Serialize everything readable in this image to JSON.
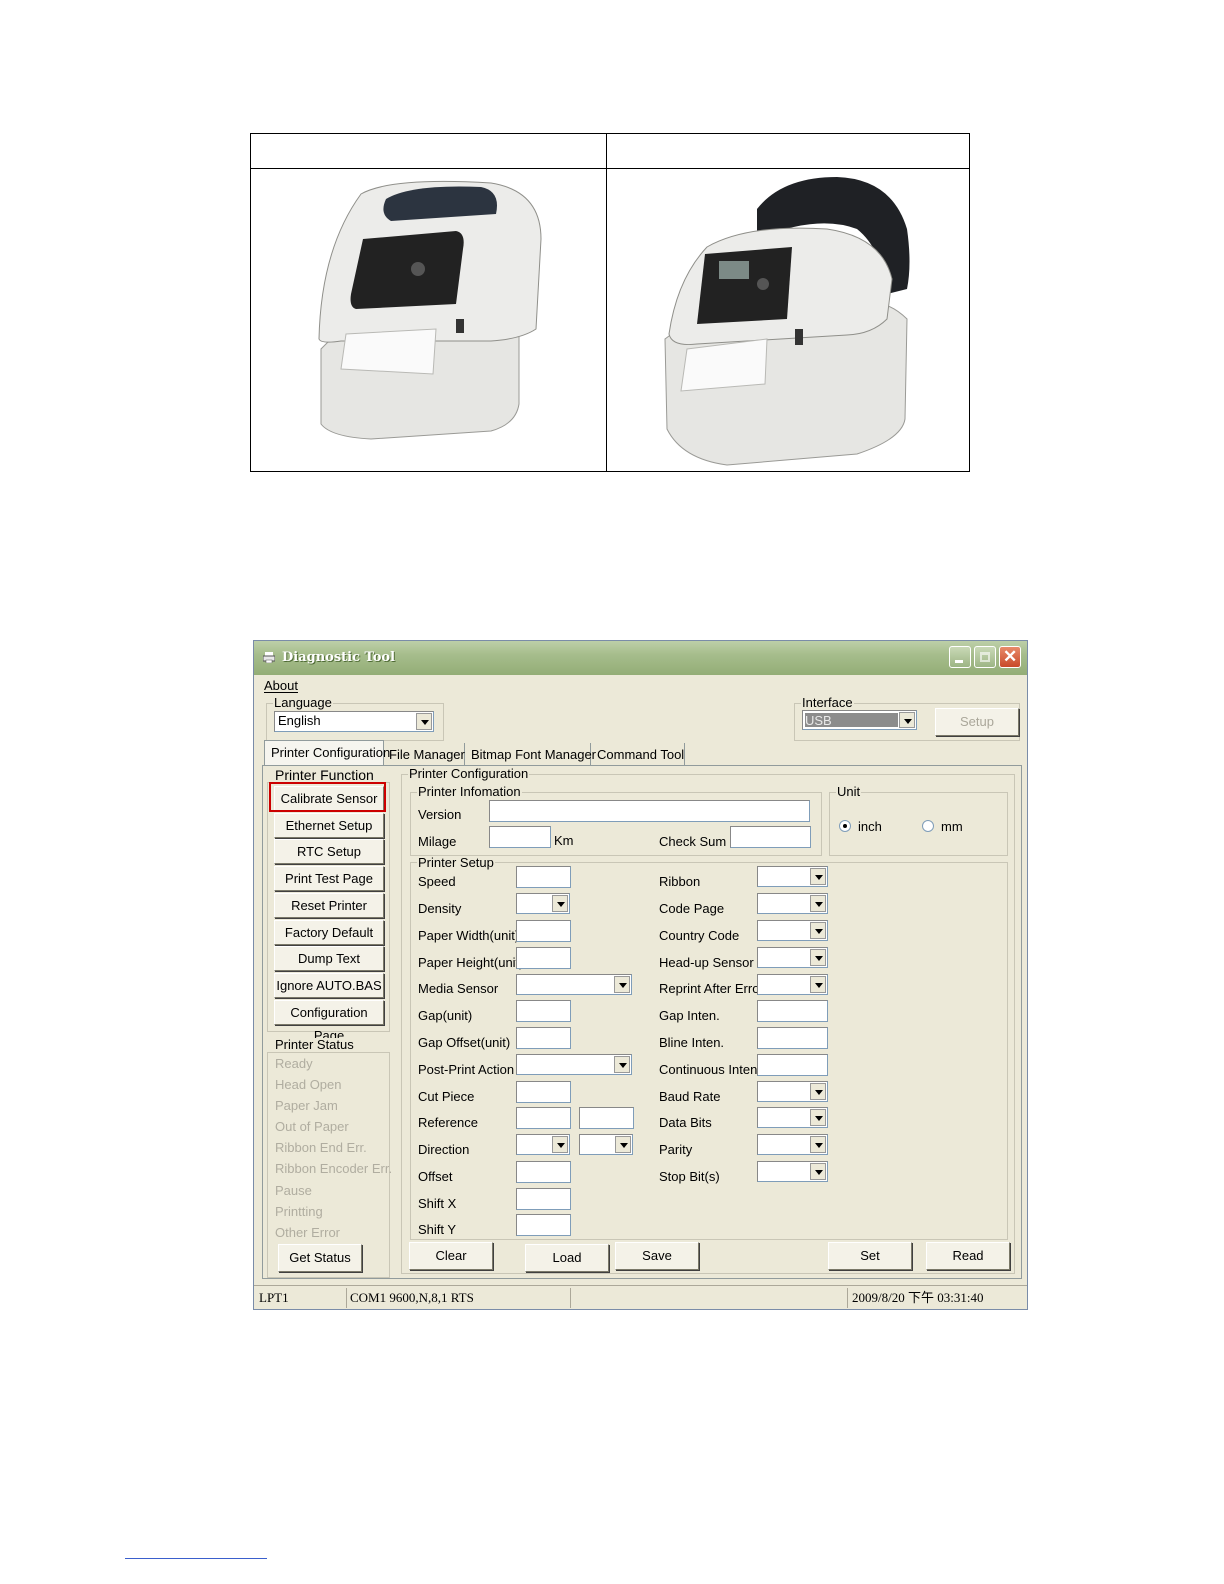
{
  "window": {
    "title": "Diagnostic Tool"
  },
  "menu": {
    "about": "About"
  },
  "language": {
    "title": "Language",
    "value": "English"
  },
  "interface": {
    "title": "Interface",
    "value": "USB",
    "setup": "Setup"
  },
  "tabs": [
    "Printer Configuration",
    "File Manager",
    "Bitmap Font Manager",
    "Command Tool"
  ],
  "printer_function": {
    "title": "Printer Function",
    "buttons": [
      "Calibrate Sensor",
      "Ethernet Setup",
      "RTC Setup",
      "Print Test Page",
      "Reset Printer",
      "Factory Default",
      "Dump Text",
      "Ignore AUTO.BAS",
      "Configuration Page"
    ],
    "highlight_color": "#cc0000"
  },
  "printer_status": {
    "title": "Printer Status",
    "items": [
      "Ready",
      "Head Open",
      "Paper Jam",
      "Out of Paper",
      "Ribbon End Err.",
      "Ribbon Encoder Err.",
      "Pause",
      "Printting",
      "Other Error"
    ],
    "get_status": "Get Status"
  },
  "printer_configuration": {
    "title": "Printer Configuration"
  },
  "printer_information": {
    "title": "Printer Infomation",
    "version": "Version",
    "milage": "Milage",
    "km": "Km",
    "check_sum": "Check Sum"
  },
  "unit": {
    "title": "Unit",
    "inch": "inch",
    "mm": "mm"
  },
  "printer_setup": {
    "title": "Printer Setup",
    "left": [
      "Speed",
      "Density",
      "Paper Width(unit)",
      "Paper Height(unit)",
      "Media Sensor",
      "Gap(unit)",
      "Gap Offset(unit)",
      "Post-Print Action",
      "Cut Piece",
      "Reference",
      "Direction",
      "Offset",
      "Shift X",
      "Shift Y"
    ],
    "right": [
      "Ribbon",
      "Code Page",
      "Country Code",
      "Head-up Sensor",
      "Reprint After Error",
      "Gap Inten.",
      "Bline Inten.",
      "Continuous Inten.",
      "Baud Rate",
      "Data Bits",
      "Parity",
      "Stop Bit(s)"
    ]
  },
  "actions": {
    "clear": "Clear",
    "load": "Load",
    "save": "Save",
    "set": "Set",
    "read": "Read"
  },
  "statusbar": {
    "port1": "LPT1",
    "port2": "COM1 9600,N,8,1 RTS",
    "datetime": "2009/8/20 下午 03:31:40"
  }
}
